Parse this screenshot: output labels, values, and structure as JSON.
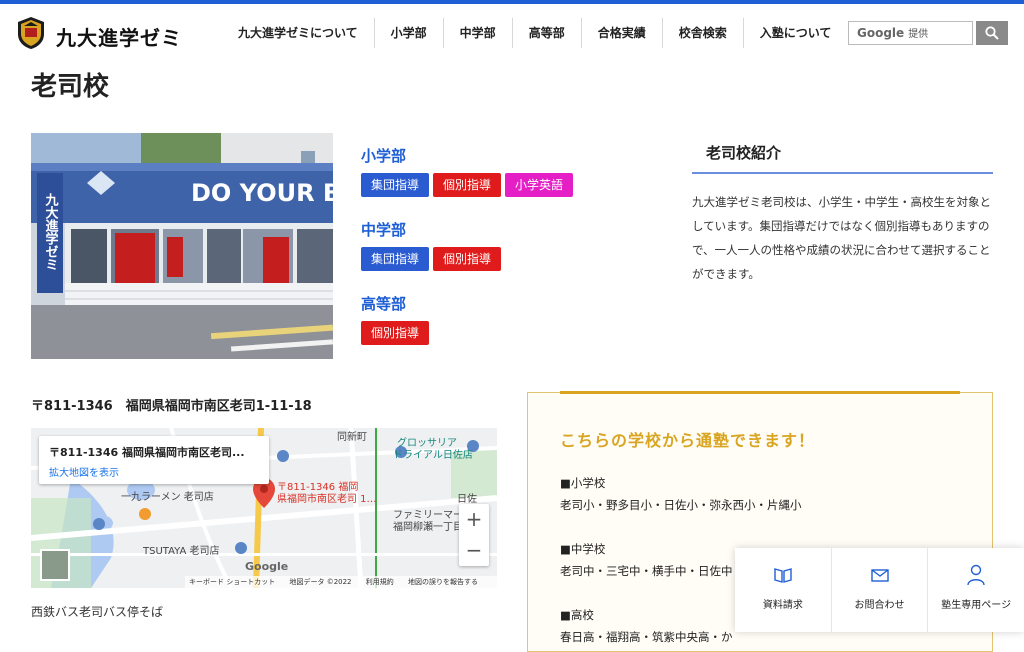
{
  "header": {
    "site_name": "九大進学ゼミ",
    "nav": [
      "九大進学ゼミについて",
      "小学部",
      "中学部",
      "高等部",
      "合格実績",
      "校舎検索",
      "入塾について"
    ],
    "search_brand": "Google",
    "search_placeholder": "提供"
  },
  "page_title": "老司校",
  "photo": {
    "sign_text": "DO YOUR BE",
    "vertical_sign": "九大進学ゼミ"
  },
  "departments": [
    {
      "name": "小学部",
      "tags": [
        {
          "label": "集団指導",
          "color": "blue"
        },
        {
          "label": "個別指導",
          "color": "red"
        },
        {
          "label": "小学英語",
          "color": "pink"
        }
      ]
    },
    {
      "name": "中学部",
      "tags": [
        {
          "label": "集団指導",
          "color": "blue"
        },
        {
          "label": "個別指導",
          "color": "red"
        }
      ]
    },
    {
      "name": "高等部",
      "tags": [
        {
          "label": "個別指導",
          "color": "red"
        }
      ]
    }
  ],
  "intro": {
    "title": "老司校紹介",
    "text": "九大進学ゼミ老司校は、小学生・中学生・高校生を対象としています。集団指導だけではなく個別指導もありますので、一人一人の性格や成績の状況に合わせて選択することができます。"
  },
  "address": "〒811-1346　福岡県福岡市南区老司1-11-18",
  "map": {
    "card_title": "〒811-1346 福岡県福岡市南区老司...",
    "card_link": "拡大地図を表示",
    "pin_label_1": "〒811-1346 福岡",
    "pin_label_2": "県福岡市南区老司 1…",
    "places": [
      "一九ラーメン 老司店",
      "TSUTAYA 老司店",
      "グロッサリア",
      "ドライアル日佐店",
      "ファミリーマート",
      "福岡柳瀬一丁目",
      "日佐",
      "同新町"
    ],
    "footer": [
      "キーボード ショートカット",
      "地図データ ©2022",
      "利用規約",
      "地図の誤りを報告する"
    ],
    "google": "Google"
  },
  "bus_stop": "西鉄バス老司バス停そば",
  "schools": {
    "title": "こちらの学校から通塾できます！",
    "categories": [
      {
        "label": "■小学校",
        "list": "老司小・野多目小・日佐小・弥永西小・片縄小"
      },
      {
        "label": "■中学校",
        "list": "老司中・三宅中・横手中・日佐中"
      },
      {
        "label": "■高校",
        "list": "春日高・福翔高・筑紫中央高・か"
      }
    ]
  },
  "quickbar": [
    "資料請求",
    "お問合わせ",
    "塾生専用ページ"
  ],
  "colors": {
    "accent_blue": "#1f5fd6",
    "tag_red": "#e01b1b",
    "tag_pink": "#e41fc6",
    "gold": "#d9a521"
  }
}
